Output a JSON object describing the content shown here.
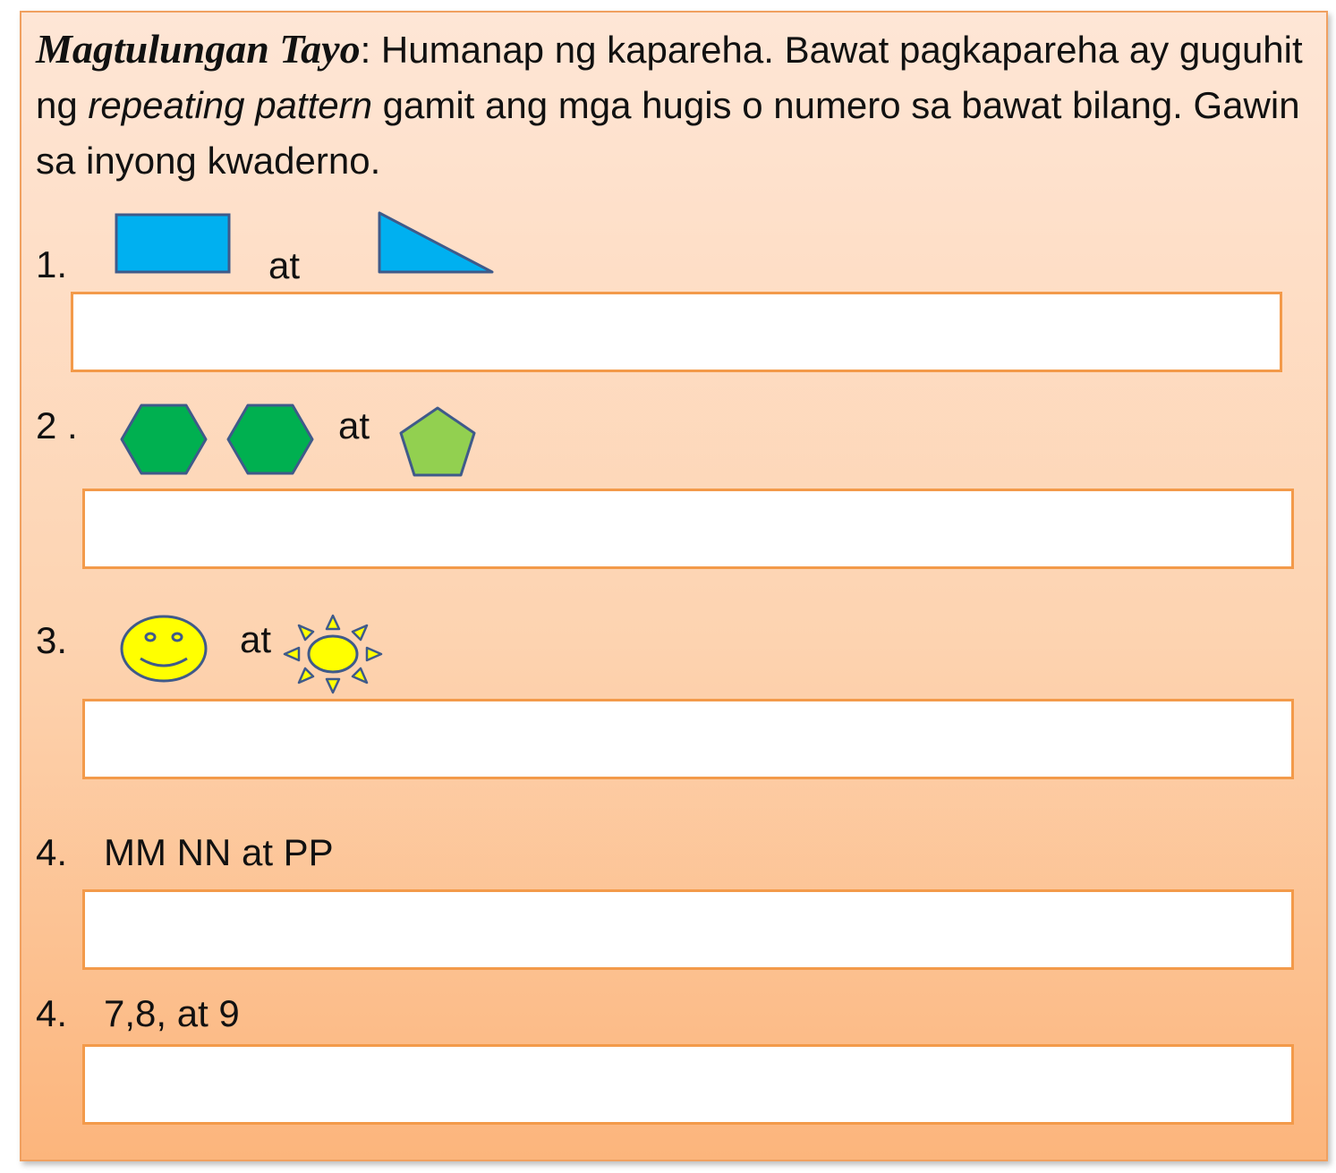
{
  "instructions": {
    "lead": "Magtulungan Tayo",
    "part1": ": Humanap ng kapareha. Bawat pagkapareha ay guguhit ng ",
    "emphasis": "repeating pattern",
    "part2": " gamit ang mga hugis o numero sa bawat bilang. Gawin sa inyong kwaderno."
  },
  "items": [
    {
      "number": "1.",
      "connector": "at",
      "shapes": [
        "rectangle-icon",
        "right-triangle-icon"
      ],
      "colors": [
        "#00b0f0",
        "#00b0f0"
      ]
    },
    {
      "number": "2 .",
      "connector": "at",
      "shapes": [
        "hexagon-icon",
        "hexagon-icon",
        "pentagon-icon"
      ],
      "colors": [
        "#00b050",
        "#00b050",
        "#92d050"
      ]
    },
    {
      "number": "3.",
      "connector": "at",
      "shapes": [
        "smiley-face-icon",
        "sun-icon"
      ],
      "colors": [
        "#ffff00",
        "#ffff00"
      ]
    },
    {
      "number": "4.",
      "text": "MM NN at PP"
    },
    {
      "number": "4.",
      "text": "7,8, at 9"
    }
  ],
  "theme": {
    "accent": "#f39a4a",
    "outline": "#3f5a8a"
  }
}
